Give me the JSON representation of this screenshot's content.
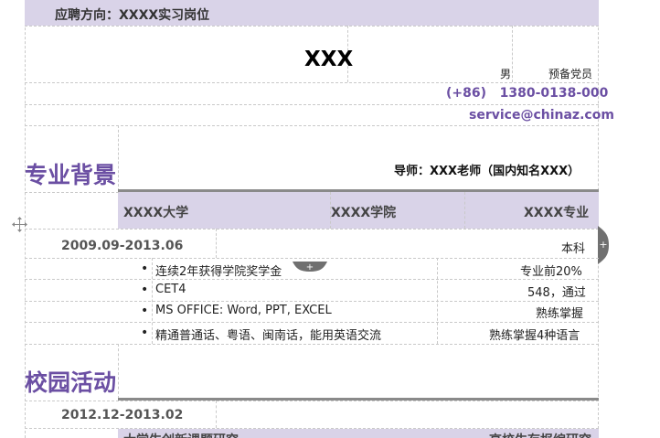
{
  "header": {
    "applying_label": "应聘方向：XXXX实习岗位",
    "name": "XXX",
    "gender": "男",
    "political_status": "预备党员",
    "phone": "(+86)   1380-0138-000",
    "email": "service@chinaz.com"
  },
  "education": {
    "section_title": "专业背景",
    "advisor": "导师：XXX老师（国内知名XXX）",
    "university": "XXXX大学",
    "college": "XXXX学院",
    "major": "XXXX专业",
    "period": "2009.09-2013.06",
    "degree": "本科",
    "items": [
      {
        "text": "连续2年获得学院奖学金",
        "value": "专业前20%"
      },
      {
        "text": "CET4",
        "value": "548，通过"
      },
      {
        "text": "MS OFFICE: Word, PPT, EXCEL",
        "value": "熟练掌握"
      },
      {
        "text": "精通普通话、粤语、闽南话，能用英语交流",
        "value": "熟练掌握4种语言"
      }
    ]
  },
  "campus": {
    "section_title": "校园活动",
    "period": "2012.12-2013.02",
    "row_left": "大学生创新课题研究",
    "row_right": "高校生存报编研究"
  },
  "ui": {
    "move_handle_icon": "move-cross-icon",
    "add_row_icon": "plus-icon",
    "add_column_icon": "plus-icon",
    "colors": {
      "accent": "#6b4fa3",
      "band": "#d9d3e8"
    }
  }
}
